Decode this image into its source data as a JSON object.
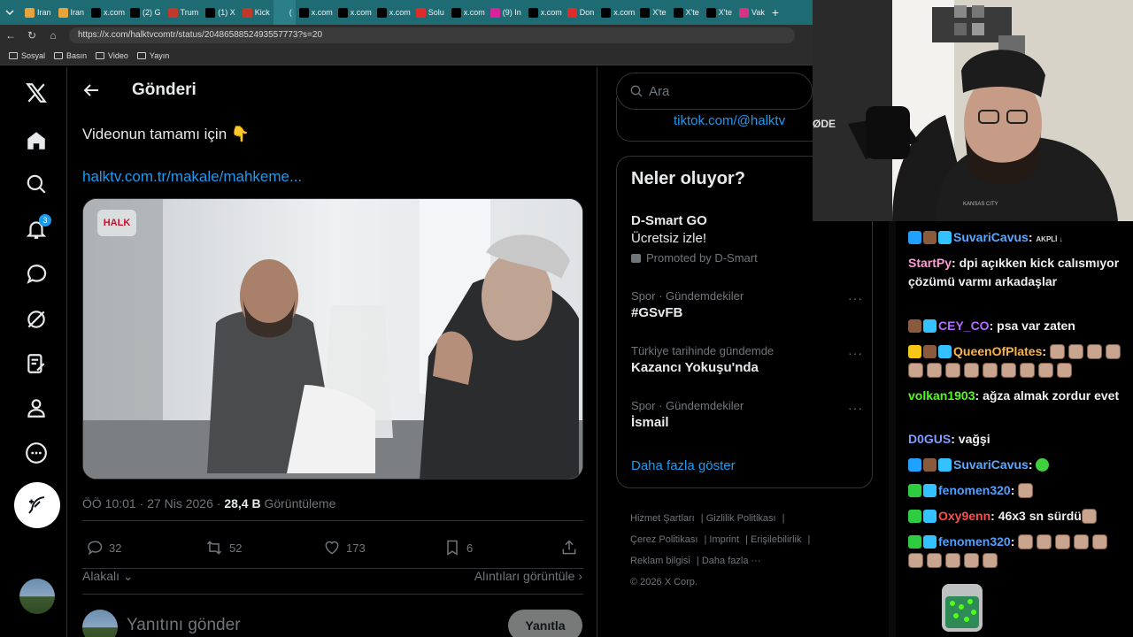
{
  "browser": {
    "tabs": [
      {
        "label": "Iran",
        "color": "#e8a33d"
      },
      {
        "label": "Iran",
        "color": "#e8a33d"
      },
      {
        "label": "x.com",
        "color": "#000000"
      },
      {
        "label": "(2) G",
        "color": "#000000"
      },
      {
        "label": "Trum",
        "color": "#c0392b"
      },
      {
        "label": "(1) X",
        "color": "#000000"
      },
      {
        "label": "Kick",
        "color": "#c0392b"
      },
      {
        "label": "(",
        "color": "#2a7f88"
      },
      {
        "label": "x.com",
        "color": "#000000"
      },
      {
        "label": "x.com",
        "color": "#000000"
      },
      {
        "label": "x.com",
        "color": "#000000"
      },
      {
        "label": "Solu",
        "color": "#e02b2b"
      },
      {
        "label": "x.com",
        "color": "#000000"
      },
      {
        "label": "(9) In",
        "color": "#d6249f"
      },
      {
        "label": "x.com",
        "color": "#000000"
      },
      {
        "label": "Don",
        "color": "#e02b2b"
      },
      {
        "label": "x.com",
        "color": "#000000"
      },
      {
        "label": "X'te",
        "color": "#000000"
      },
      {
        "label": "X'te",
        "color": "#000000"
      },
      {
        "label": "X'te",
        "color": "#000000"
      },
      {
        "label": "Vak",
        "color": "#d63384"
      }
    ],
    "url": "https://x.com/halktvcomtr/status/2048658852493557773?s=20",
    "bookmarks": [
      "Sosyal",
      "Basın",
      "Video",
      "Yayın"
    ]
  },
  "rail": {
    "notif_count": "3"
  },
  "post": {
    "header_title": "Gönderi",
    "text": "Videonun tamamı için 👇",
    "link": "halktv.com.tr/makale/mahkeme...",
    "video_logo": "HALK",
    "time": "ÖÖ 10:01 · 27 Nis 2026 · ",
    "views_count": "28,4 B",
    "views_label": " Görüntüleme",
    "replies": "32",
    "reposts": "52",
    "likes": "173",
    "bookmarks": "6",
    "related_label": "Alakalı",
    "quotes_label": "Alıntıları görüntüle",
    "reply_placeholder": "Yanıtını gönder",
    "reply_button": "Yanıtla"
  },
  "sidebar": {
    "search_placeholder": "Ara",
    "profile_link": "tiktok.com/@halktv",
    "trends_title": "Neler oluyor?",
    "promo": {
      "name": "D-Smart GO",
      "sub": "Ücretsiz izle!",
      "promoted": "Promoted by D-Smart"
    },
    "trends": [
      {
        "category": "Spor · Gündemdekiler",
        "name": "#GSvFB"
      },
      {
        "category": "Türkiye tarihinde gündemde",
        "name": "Kazancı Yokuşu'nda"
      },
      {
        "category": "Spor · Gündemdekiler",
        "name": "İsmail"
      }
    ],
    "show_more": "Daha fazla göster",
    "footer": {
      "items": [
        "Hizmet Şartları",
        "Gizlilik Politikası",
        "Çerez Politikası",
        "Imprint",
        "Erişilebilirlik",
        "Reklam bilgisi",
        "Daha fazla ···"
      ],
      "copyright": "© 2026 X Corp."
    }
  },
  "webcam": {
    "shirt_text": "KANSAS CITY",
    "mic_text": "ØDE"
  },
  "chat": {
    "messages": [
      {
        "user": "SuvariCavus",
        "color": "#5aa9ff",
        "text": "",
        "badges": [
          "#20a0ff",
          "#8a5a3c",
          "#33c1ff"
        ],
        "emote": "AKPLİ ↓"
      },
      {
        "user": "StartPy",
        "color": "#ff9ad5",
        "text": "dpi açıkken kick calısmıyor çözümü varmı arkadaşlar",
        "badges": []
      },
      {
        "user": "CEY_CO",
        "color": "#b56cff",
        "text": "psa var zaten",
        "badges": [
          "#8a5a3c",
          "#33c1ff"
        ]
      },
      {
        "user": "QueenOfPlates",
        "color": "#ffb347",
        "text": "",
        "badges": [
          "#f5c518",
          "#8a5a3c",
          "#33c1ff"
        ]
      },
      {
        "user": "volkan1903",
        "color": "#53fc18",
        "text": "ağza almak zordur evet",
        "badges": []
      },
      {
        "user": "D0GUS",
        "color": "#7f9cff",
        "text": "vağşi",
        "badges": []
      },
      {
        "user": "SuvariCavus",
        "color": "#5aa9ff",
        "text": "",
        "badges": [
          "#20a0ff",
          "#8a5a3c",
          "#33c1ff"
        ]
      },
      {
        "user": "fenomen320",
        "color": "#4fa0ff",
        "text": "",
        "badges": [
          "#2ecc40",
          "#33c1ff"
        ]
      },
      {
        "user": "Oxy9enn",
        "color": "#ff4d4d",
        "text": "46x3 sn sürdü",
        "badges": [
          "#2ecc40",
          "#33c1ff"
        ]
      },
      {
        "user": "fenomen320",
        "color": "#4fa0ff",
        "text": "",
        "badges": [
          "#2ecc40",
          "#33c1ff"
        ]
      }
    ]
  }
}
